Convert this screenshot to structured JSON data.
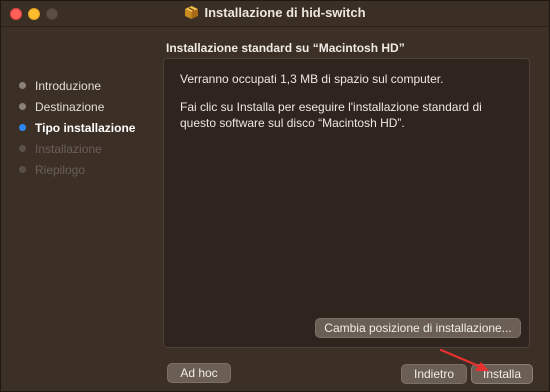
{
  "window": {
    "title": "Installazione di hid-switch",
    "icon": "package-icon",
    "colors": {
      "background": "#3b2f26",
      "panel": "#2f251e",
      "accent": "#2f86f6",
      "button": "#6a5e55",
      "annotation_arrow": "#e8312f"
    }
  },
  "header": {
    "subtitle": "Installazione standard su “Macintosh HD”"
  },
  "sidebar": {
    "steps": [
      {
        "label": "Introduzione",
        "state": "done"
      },
      {
        "label": "Destinazione",
        "state": "done"
      },
      {
        "label": "Tipo installazione",
        "state": "active"
      },
      {
        "label": "Installazione",
        "state": "pending"
      },
      {
        "label": "Riepilogo",
        "state": "pending"
      }
    ]
  },
  "main": {
    "paragraph1": "Verranno occupati 1,3 MB di spazio sul computer.",
    "paragraph2": "Fai clic su Installa per eseguire l'installazione standard di questo software sul disco “Macintosh HD”.",
    "change_location_label": "Cambia posizione di installazione..."
  },
  "footer": {
    "adhoc_label": "Ad hoc",
    "back_label": "Indietro",
    "install_label": "Installa"
  }
}
